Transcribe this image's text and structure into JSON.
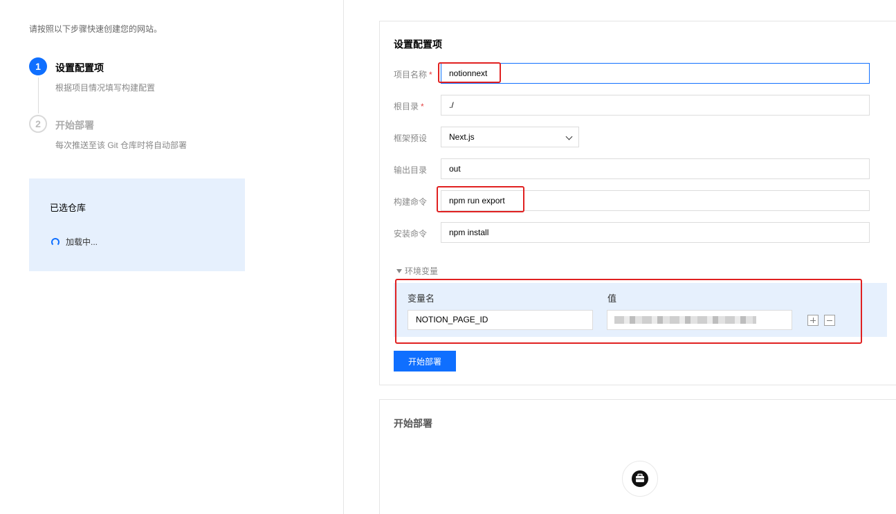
{
  "left": {
    "intro": "请按照以下步骤快速创建您的网站。",
    "steps": [
      {
        "number": "1",
        "title": "设置配置项",
        "desc": "根据项目情况填写构建配置"
      },
      {
        "number": "2",
        "title": "开始部署",
        "desc": "每次推送至该 Git 仓库时将自动部署"
      }
    ],
    "repo": {
      "title": "已选仓库",
      "loading": "加载中..."
    }
  },
  "config": {
    "title": "设置配置项",
    "fields": {
      "project_name": {
        "label": "项目名称",
        "required_mark": "*",
        "value": "notionnext"
      },
      "root_dir": {
        "label": "根目录",
        "required_mark": "*",
        "value": "./"
      },
      "framework": {
        "label": "框架预设",
        "value": "Next.js"
      },
      "output_dir": {
        "label": "输出目录",
        "value": "out"
      },
      "build_cmd": {
        "label": "构建命令",
        "value": "npm run export"
      },
      "install_cmd": {
        "label": "安装命令",
        "value": "npm install"
      }
    },
    "env": {
      "toggle_label": "环境变量",
      "name_header": "变量名",
      "value_header": "值",
      "name_value": "NOTION_PAGE_ID"
    },
    "start_button": "开始部署"
  },
  "deploy": {
    "title": "开始部署"
  },
  "colors": {
    "primary": "#0f6fff",
    "highlight": "#e02020",
    "panel_bg": "#e6f0fd",
    "required": "#e54545"
  },
  "icons": {
    "add": "plus-square-icon",
    "remove": "minus-square-icon",
    "deploy": "package-icon",
    "loading": "spinner-icon"
  }
}
